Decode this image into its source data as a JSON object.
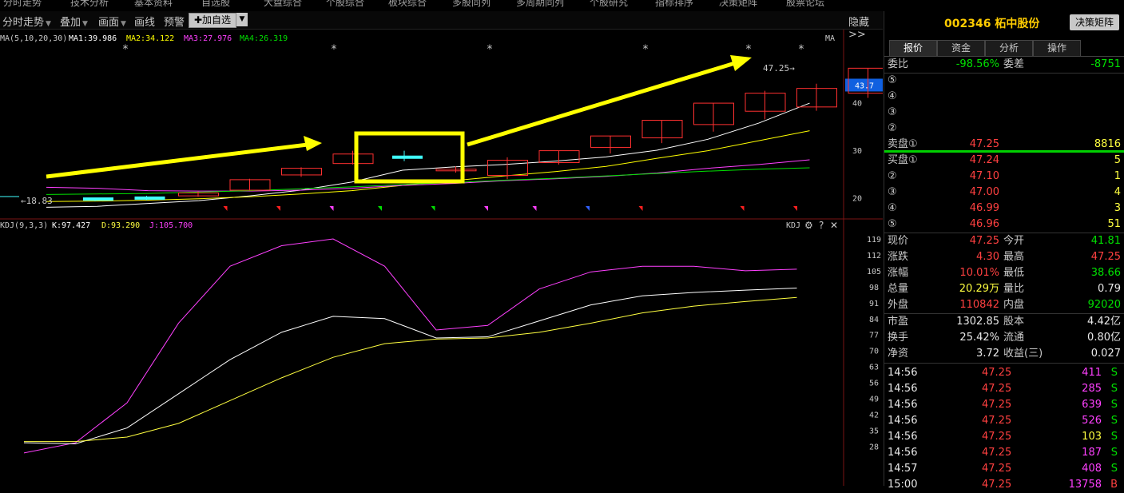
{
  "topnav": [
    "分时走势",
    "技术分析",
    "基本资料",
    "自选股",
    "大盘综合",
    "个股综合",
    "板块综合",
    "多股同列",
    "多周期同列",
    "个股研究",
    "指标排序",
    "决策矩阵",
    "股票论坛"
  ],
  "toolbar": {
    "trend": "分时走势",
    "overlay": "叠加",
    "canvas": "画面",
    "draw": "画线",
    "alert": "预警",
    "add_watch": "✚加自选",
    "hide": "隐藏>>"
  },
  "main_chart": {
    "ma_params": "MA(5,10,20,30)",
    "ma_values": [
      {
        "label": "MA1:39.986",
        "color": "#ffffff"
      },
      {
        "label": "MA2:34.122",
        "color": "#ffff00"
      },
      {
        "label": "MA3:27.976",
        "color": "#ff40ff"
      },
      {
        "label": "MA4:26.319",
        "color": "#00e000"
      }
    ],
    "right_tag": "MA",
    "y_ticks": [
      {
        "v": 40,
        "t": "40"
      },
      {
        "v": 30,
        "t": "30"
      },
      {
        "v": 20,
        "t": "20"
      }
    ],
    "current_price_badge": "43.7",
    "high_label": "47.25→",
    "low_label": "←18.83",
    "candles": [
      {
        "o": 19.9,
        "c": 19.4,
        "h": 19.9,
        "l": 19.3
      },
      {
        "o": 20.1,
        "c": 19.8,
        "h": 20.4,
        "l": 19.5
      },
      {
        "o": 20.4,
        "c": 21.0,
        "h": 21.3,
        "l": 20.2
      },
      {
        "o": 21.6,
        "c": 23.8,
        "h": 24.0,
        "l": 21.5
      },
      {
        "o": 24.8,
        "c": 26.2,
        "h": 26.4,
        "l": 24.4
      },
      {
        "o": 27.2,
        "c": 29.2,
        "h": 29.9,
        "l": 27.0
      },
      {
        "o": 28.7,
        "c": 28.6,
        "h": 29.9,
        "l": 27.7
      },
      {
        "o": 26.0,
        "c": 26.0,
        "h": 26.6,
        "l": 25.3
      },
      {
        "o": 24.7,
        "c": 27.9,
        "h": 28.5,
        "l": 23.9
      },
      {
        "o": 27.4,
        "c": 29.9,
        "h": 29.9,
        "l": 27.0
      },
      {
        "o": 30.6,
        "c": 33.0,
        "h": 33.0,
        "l": 29.3
      },
      {
        "o": 32.6,
        "c": 36.3,
        "h": 36.3,
        "l": 31.5
      },
      {
        "o": 35.4,
        "c": 39.9,
        "h": 39.9,
        "l": 33.9
      },
      {
        "o": 38.2,
        "c": 42.0,
        "h": 42.5,
        "l": 36.5
      },
      {
        "o": 39.1,
        "c": 43.0,
        "h": 44.0,
        "l": 38.3
      },
      {
        "o": 42.0,
        "c": 47.25,
        "h": 47.25,
        "l": 41.0
      }
    ],
    "ma_lines": {
      "ma1": [
        18.0,
        18.2,
        18.8,
        19.4,
        20.4,
        21.6,
        23.3,
        25.8,
        26.5,
        27.0,
        27.7,
        28.6,
        30.0,
        32.3,
        35.7,
        39.9
      ],
      "ma2": [
        19.2,
        19.3,
        19.5,
        19.8,
        20.2,
        20.8,
        21.5,
        22.6,
        23.6,
        24.6,
        25.5,
        26.6,
        28.3,
        29.9,
        32.0,
        34.1
      ],
      "ma3": [
        22.2,
        22.0,
        21.5,
        21.4,
        21.4,
        21.6,
        22.0,
        22.6,
        23.0,
        23.6,
        24.0,
        24.5,
        25.2,
        26.2,
        27.0,
        27.98
      ],
      "ma4": [
        20.7,
        20.8,
        20.9,
        21.2,
        21.5,
        21.9,
        22.3,
        22.8,
        23.2,
        23.7,
        24.1,
        24.6,
        25.1,
        25.6,
        26.0,
        26.3
      ]
    },
    "stars": [
      "*",
      "*",
      "*",
      "*",
      "*",
      "*"
    ],
    "markers": [
      {
        "i": 3,
        "color": "#ff2020"
      },
      {
        "i": 4,
        "color": "#ff2020"
      },
      {
        "i": 5,
        "color": "#ff40ff"
      },
      {
        "i": 6,
        "color": "#00e000"
      },
      {
        "i": 7,
        "color": "#00e000"
      },
      {
        "i": 8,
        "color": "#ff40ff"
      },
      {
        "i": 9,
        "color": "#ff40ff"
      },
      {
        "i": 10,
        "color": "#3060ff"
      },
      {
        "i": 11,
        "color": "#ff2020"
      },
      {
        "i": 13,
        "color": "#ff2020"
      },
      {
        "i": 14,
        "color": "#ff2020"
      }
    ]
  },
  "kdj_chart": {
    "params": "KDJ(9,3,3)",
    "k_label": "K:97.427",
    "d_label": "D:93.290",
    "j_label": "J:105.700",
    "tag": "KDJ",
    "y_ticks": [
      "119",
      "112",
      "105",
      "98",
      "91",
      "84",
      "77",
      "70",
      "63",
      "56",
      "49",
      "42",
      "35",
      "28"
    ],
    "k": [
      29.5,
      29.0,
      36.0,
      51.0,
      66.0,
      78.0,
      85.0,
      84.0,
      75.5,
      76.0,
      83.0,
      90.0,
      94.0,
      95.5,
      96.5,
      97.4
    ],
    "d": [
      30.0,
      30.0,
      32.0,
      38.0,
      48.0,
      58.0,
      67.0,
      73.0,
      75.0,
      75.5,
      78.0,
      82.0,
      86.5,
      89.5,
      91.5,
      93.3
    ],
    "j": [
      25.0,
      29.5,
      47.0,
      82.0,
      107.0,
      116.0,
      119.0,
      107.0,
      79.0,
      81.0,
      97.0,
      104.5,
      107.0,
      107.0,
      105.0,
      105.7
    ]
  },
  "quote": {
    "code": "002346",
    "name": "柘中股份",
    "decision_btn": "决策矩阵",
    "tabs": [
      "报价",
      "资金",
      "分析",
      "操作"
    ],
    "weibi_label": "委比",
    "weibi": "-98.56%",
    "weicha_label": "委差",
    "weicha": "-8751",
    "sell": [
      {
        "lvl": "⑤",
        "price": "",
        "vol": ""
      },
      {
        "lvl": "④",
        "price": "",
        "vol": ""
      },
      {
        "lvl": "③",
        "price": "",
        "vol": ""
      },
      {
        "lvl": "②",
        "price": "",
        "vol": ""
      },
      {
        "lvl": "卖盘①",
        "price": "47.25",
        "vol": "8816"
      }
    ],
    "buy": [
      {
        "lvl": "买盘①",
        "price": "47.24",
        "vol": "5"
      },
      {
        "lvl": "②",
        "price": "47.10",
        "vol": "1"
      },
      {
        "lvl": "③",
        "price": "47.00",
        "vol": "4"
      },
      {
        "lvl": "④",
        "price": "46.99",
        "vol": "3"
      },
      {
        "lvl": "⑤",
        "price": "46.96",
        "vol": "51"
      }
    ],
    "stats": [
      {
        "l1": "现价",
        "v1": "47.25",
        "c1": "red",
        "l2": "今开",
        "v2": "41.81",
        "c2": "green"
      },
      {
        "l1": "涨跌",
        "v1": "4.30",
        "c1": "red",
        "l2": "最高",
        "v2": "47.25",
        "c2": "red"
      },
      {
        "l1": "涨幅",
        "v1": "10.01%",
        "c1": "red",
        "l2": "最低",
        "v2": "38.66",
        "c2": "green"
      },
      {
        "l1": "总量",
        "v1": "20.29万",
        "c1": "yellow",
        "l2": "量比",
        "v2": "0.79",
        "c2": "white"
      },
      {
        "l1": "外盘",
        "v1": "110842",
        "c1": "red",
        "l2": "内盘",
        "v2": "92020",
        "c2": "green"
      },
      {
        "l1": "市盈",
        "v1": "1302.85",
        "c1": "white",
        "l2": "股本",
        "v2": "4.42亿",
        "c2": "white"
      },
      {
        "l1": "换手",
        "v1": "25.42%",
        "c1": "white",
        "l2": "流通",
        "v2": "0.80亿",
        "c2": "white"
      },
      {
        "l1": "净资",
        "v1": "3.72",
        "c1": "white",
        "l2": "收益(三)",
        "v2": "0.027",
        "c2": "white"
      }
    ],
    "ticks": [
      {
        "time": "14:56",
        "price": "47.25",
        "vol": "411",
        "vc": "mag",
        "side": "S"
      },
      {
        "time": "14:56",
        "price": "47.25",
        "vol": "285",
        "vc": "mag",
        "side": "S"
      },
      {
        "time": "14:56",
        "price": "47.25",
        "vol": "639",
        "vc": "mag",
        "side": "S"
      },
      {
        "time": "14:56",
        "price": "47.25",
        "vol": "526",
        "vc": "mag",
        "side": "S"
      },
      {
        "time": "14:56",
        "price": "47.25",
        "vol": "103",
        "vc": "yellow",
        "side": "S"
      },
      {
        "time": "14:56",
        "price": "47.25",
        "vol": "187",
        "vc": "mag",
        "side": "S"
      },
      {
        "time": "14:57",
        "price": "47.25",
        "vol": "408",
        "vc": "mag",
        "side": "S"
      },
      {
        "time": "15:00",
        "price": "47.25",
        "vol": "13758",
        "vc": "mag",
        "side": "B"
      }
    ]
  }
}
